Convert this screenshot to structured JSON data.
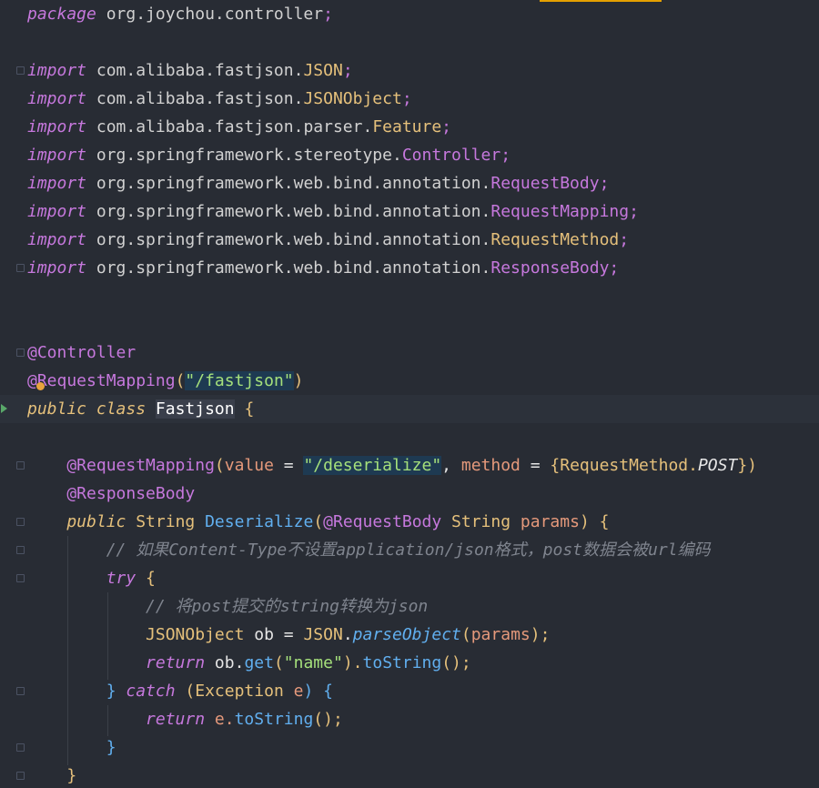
{
  "editor": {
    "language": "Java",
    "lines": [
      {
        "tokens": [
          {
            "t": "package",
            "c": "kw"
          },
          {
            "t": " org.joychou.controller",
            "c": "pkg"
          },
          {
            "t": ";",
            "c": "semi"
          }
        ]
      },
      {
        "tokens": []
      },
      {
        "tokens": [
          {
            "t": "import",
            "c": "kw"
          },
          {
            "t": " com.alibaba.fastjson.",
            "c": "pkg"
          },
          {
            "t": "JSON",
            "c": "ty"
          },
          {
            "t": ";",
            "c": "semi"
          }
        ]
      },
      {
        "tokens": [
          {
            "t": "import",
            "c": "kw"
          },
          {
            "t": " com.alibaba.fastjson.",
            "c": "pkg"
          },
          {
            "t": "JSONObject",
            "c": "ty"
          },
          {
            "t": ";",
            "c": "semi"
          }
        ]
      },
      {
        "tokens": [
          {
            "t": "import",
            "c": "kw"
          },
          {
            "t": " com.alibaba.fastjson.parser.",
            "c": "pkg"
          },
          {
            "t": "Feature",
            "c": "ty"
          },
          {
            "t": ";",
            "c": "semi"
          }
        ]
      },
      {
        "tokens": [
          {
            "t": "import",
            "c": "kw"
          },
          {
            "t": " org.springframework.stereotype.",
            "c": "pkg"
          },
          {
            "t": "Controller",
            "c": "cls"
          },
          {
            "t": ";",
            "c": "semi"
          }
        ]
      },
      {
        "tokens": [
          {
            "t": "import",
            "c": "kw"
          },
          {
            "t": " org.springframework.web.bind.annotation.",
            "c": "pkg"
          },
          {
            "t": "RequestBody",
            "c": "cls"
          },
          {
            "t": ";",
            "c": "semi"
          }
        ]
      },
      {
        "tokens": [
          {
            "t": "import",
            "c": "kw"
          },
          {
            "t": " org.springframework.web.bind.annotation.",
            "c": "pkg"
          },
          {
            "t": "RequestMapping",
            "c": "cls"
          },
          {
            "t": ";",
            "c": "semi"
          }
        ]
      },
      {
        "tokens": [
          {
            "t": "import",
            "c": "kw"
          },
          {
            "t": " org.springframework.web.bind.annotation.",
            "c": "pkg"
          },
          {
            "t": "RequestMethod",
            "c": "ty"
          },
          {
            "t": ";",
            "c": "semi"
          }
        ]
      },
      {
        "tokens": [
          {
            "t": "import",
            "c": "kw"
          },
          {
            "t": " org.springframework.web.bind.annotation.",
            "c": "pkg"
          },
          {
            "t": "ResponseBody",
            "c": "cls"
          },
          {
            "t": ";",
            "c": "semi"
          }
        ]
      },
      {
        "tokens": []
      },
      {
        "tokens": []
      },
      {
        "tokens": [
          {
            "t": "@Controller",
            "c": "ann"
          }
        ]
      },
      {
        "tokens": [
          {
            "t": "@RequestMapping",
            "c": "ann"
          },
          {
            "t": "(",
            "c": "punc"
          },
          {
            "t": "\"/fastjson\"",
            "c": "str str-hl"
          },
          {
            "t": ")",
            "c": "punc"
          }
        ]
      },
      {
        "tokens": [
          {
            "t": "public",
            "c": "kwp"
          },
          {
            "t": " ",
            "c": "plain"
          },
          {
            "t": "class",
            "c": "kwp"
          },
          {
            "t": " ",
            "c": "plain"
          },
          {
            "t": "Fastjson",
            "c": "name-hl"
          },
          {
            "t": " {",
            "c": "punc"
          }
        ]
      },
      {
        "tokens": []
      },
      {
        "tokens": [
          {
            "t": "    @RequestMapping",
            "c": "ann"
          },
          {
            "t": "(",
            "c": "punc"
          },
          {
            "t": "value",
            "c": "param"
          },
          {
            "t": " = ",
            "c": "plain"
          },
          {
            "t": "\"/deserialize\"",
            "c": "str str-hl"
          },
          {
            "t": ", ",
            "c": "plain"
          },
          {
            "t": "method",
            "c": "param"
          },
          {
            "t": " = ",
            "c": "plain"
          },
          {
            "t": "{",
            "c": "punc"
          },
          {
            "t": "RequestMethod.",
            "c": "ty"
          },
          {
            "t": "POST",
            "c": "const"
          },
          {
            "t": "})",
            "c": "punc"
          }
        ]
      },
      {
        "tokens": [
          {
            "t": "    @ResponseBody",
            "c": "ann"
          }
        ]
      },
      {
        "tokens": [
          {
            "t": "    public",
            "c": "kwp"
          },
          {
            "t": " ",
            "c": "plain"
          },
          {
            "t": "String",
            "c": "ty"
          },
          {
            "t": " ",
            "c": "plain"
          },
          {
            "t": "Deserialize",
            "c": "fn"
          },
          {
            "t": "(",
            "c": "punc"
          },
          {
            "t": "@RequestBody",
            "c": "ann"
          },
          {
            "t": " ",
            "c": "plain"
          },
          {
            "t": "String",
            "c": "ty"
          },
          {
            "t": " params",
            "c": "param"
          },
          {
            "t": ") {",
            "c": "punc"
          }
        ]
      },
      {
        "tokens": [
          {
            "t": "        // 如果Content-Type不设置application/json格式，post数据会被url编码",
            "c": "cmt"
          }
        ]
      },
      {
        "tokens": [
          {
            "t": "        try",
            "c": "kw"
          },
          {
            "t": " {",
            "c": "punc"
          }
        ]
      },
      {
        "tokens": [
          {
            "t": "            // 将post提交的string转换为json",
            "c": "cmt"
          }
        ]
      },
      {
        "tokens": [
          {
            "t": "            JSONObject",
            "c": "ty"
          },
          {
            "t": " ob = ",
            "c": "plain"
          },
          {
            "t": "JSON",
            "c": "ty"
          },
          {
            "t": ".",
            "c": "plain"
          },
          {
            "t": "parseObject",
            "c": "fn-it"
          },
          {
            "t": "(",
            "c": "punc"
          },
          {
            "t": "params",
            "c": "param"
          },
          {
            "t": ");",
            "c": "punc"
          }
        ]
      },
      {
        "tokens": [
          {
            "t": "            return",
            "c": "kw"
          },
          {
            "t": " ob.",
            "c": "plain"
          },
          {
            "t": "get",
            "c": "fn"
          },
          {
            "t": "(",
            "c": "punc"
          },
          {
            "t": "\"name\"",
            "c": "str"
          },
          {
            "t": ").",
            "c": "punc"
          },
          {
            "t": "toString",
            "c": "fn"
          },
          {
            "t": "();",
            "c": "punc"
          }
        ]
      },
      {
        "tokens": [
          {
            "t": "        } ",
            "c": "fn"
          },
          {
            "t": "catch",
            "c": "kw"
          },
          {
            "t": " (",
            "c": "punc"
          },
          {
            "t": "Exception",
            "c": "ty"
          },
          {
            "t": " e",
            "c": "param"
          },
          {
            "t": ") {",
            "c": "fn"
          }
        ]
      },
      {
        "tokens": [
          {
            "t": "            return",
            "c": "kw"
          },
          {
            "t": " e.",
            "c": "param"
          },
          {
            "t": "toString",
            "c": "fn"
          },
          {
            "t": "();",
            "c": "punc"
          }
        ]
      },
      {
        "tokens": [
          {
            "t": "        }",
            "c": "fn"
          }
        ]
      },
      {
        "tokens": [
          {
            "t": "    }",
            "c": "punc"
          }
        ]
      }
    ]
  }
}
